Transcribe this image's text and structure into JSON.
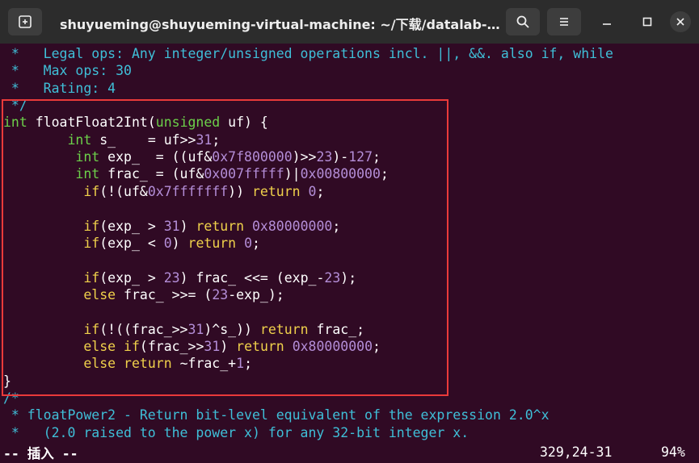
{
  "window": {
    "title": "shuyueming@shuyueming-virtual-machine: ~/下载/datalab-h..."
  },
  "lines": [
    {
      "segments": [
        {
          "c": "c",
          "t": " *   Legal ops: Any integer/unsigned operations incl. ||, &&. also if, while"
        }
      ]
    },
    {
      "segments": [
        {
          "c": "c",
          "t": " *   Max ops: 30"
        }
      ]
    },
    {
      "segments": [
        {
          "c": "c",
          "t": " *   Rating: 4"
        }
      ]
    },
    {
      "segments": [
        {
          "c": "c",
          "t": " */"
        }
      ]
    },
    {
      "segments": [
        {
          "c": "t",
          "t": "int"
        },
        {
          "c": "w",
          "t": " floatFloat2Int("
        },
        {
          "c": "t",
          "t": "unsigned"
        },
        {
          "c": "w",
          "t": " uf) {"
        }
      ]
    },
    {
      "segments": [
        {
          "c": "w",
          "t": "        "
        },
        {
          "c": "t",
          "t": "int"
        },
        {
          "c": "w",
          "t": " s_    = uf>>"
        },
        {
          "c": "n",
          "t": "31"
        },
        {
          "c": "w",
          "t": ";"
        }
      ]
    },
    {
      "segments": [
        {
          "c": "w",
          "t": "         "
        },
        {
          "c": "t",
          "t": "int"
        },
        {
          "c": "w",
          "t": " exp_  = ((uf&"
        },
        {
          "c": "n",
          "t": "0x7f800000"
        },
        {
          "c": "w",
          "t": ")>>"
        },
        {
          "c": "n",
          "t": "23"
        },
        {
          "c": "w",
          "t": ")-"
        },
        {
          "c": "n",
          "t": "127"
        },
        {
          "c": "w",
          "t": ";"
        }
      ]
    },
    {
      "segments": [
        {
          "c": "w",
          "t": "         "
        },
        {
          "c": "t",
          "t": "int"
        },
        {
          "c": "w",
          "t": " frac_ = (uf&"
        },
        {
          "c": "n",
          "t": "0x007fffff"
        },
        {
          "c": "w",
          "t": ")|"
        },
        {
          "c": "n",
          "t": "0x00800000"
        },
        {
          "c": "w",
          "t": ";"
        }
      ]
    },
    {
      "segments": [
        {
          "c": "w",
          "t": "          "
        },
        {
          "c": "k",
          "t": "if"
        },
        {
          "c": "w",
          "t": "(!(uf&"
        },
        {
          "c": "n",
          "t": "0x7fffffff"
        },
        {
          "c": "w",
          "t": ")) "
        },
        {
          "c": "k",
          "t": "return"
        },
        {
          "c": "w",
          "t": " "
        },
        {
          "c": "n",
          "t": "0"
        },
        {
          "c": "w",
          "t": ";"
        }
      ]
    },
    {
      "segments": [
        {
          "c": "w",
          "t": ""
        }
      ]
    },
    {
      "segments": [
        {
          "c": "w",
          "t": "          "
        },
        {
          "c": "k",
          "t": "if"
        },
        {
          "c": "w",
          "t": "(exp_ > "
        },
        {
          "c": "n",
          "t": "31"
        },
        {
          "c": "w",
          "t": ") "
        },
        {
          "c": "k",
          "t": "return"
        },
        {
          "c": "w",
          "t": " "
        },
        {
          "c": "n",
          "t": "0x80000000"
        },
        {
          "c": "w",
          "t": ";"
        }
      ]
    },
    {
      "segments": [
        {
          "c": "w",
          "t": "          "
        },
        {
          "c": "k",
          "t": "if"
        },
        {
          "c": "w",
          "t": "(exp_ < "
        },
        {
          "c": "n",
          "t": "0"
        },
        {
          "c": "w",
          "t": ") "
        },
        {
          "c": "k",
          "t": "return"
        },
        {
          "c": "w",
          "t": " "
        },
        {
          "c": "n",
          "t": "0"
        },
        {
          "c": "w",
          "t": ";"
        }
      ]
    },
    {
      "segments": [
        {
          "c": "w",
          "t": ""
        }
      ]
    },
    {
      "segments": [
        {
          "c": "w",
          "t": "          "
        },
        {
          "c": "k",
          "t": "if"
        },
        {
          "c": "w",
          "t": "(exp_ > "
        },
        {
          "c": "n",
          "t": "23"
        },
        {
          "c": "w",
          "t": ") frac_ <<= (exp_-"
        },
        {
          "c": "n",
          "t": "23"
        },
        {
          "c": "w",
          "t": ");"
        }
      ]
    },
    {
      "segments": [
        {
          "c": "w",
          "t": "          "
        },
        {
          "c": "k",
          "t": "else"
        },
        {
          "c": "w",
          "t": " frac_ >>= ("
        },
        {
          "c": "n",
          "t": "23"
        },
        {
          "c": "w",
          "t": "-exp_);"
        }
      ]
    },
    {
      "segments": [
        {
          "c": "w",
          "t": ""
        }
      ]
    },
    {
      "segments": [
        {
          "c": "w",
          "t": "          "
        },
        {
          "c": "k",
          "t": "if"
        },
        {
          "c": "w",
          "t": "(!((frac_>>"
        },
        {
          "c": "n",
          "t": "31"
        },
        {
          "c": "w",
          "t": ")^s_)) "
        },
        {
          "c": "k",
          "t": "return"
        },
        {
          "c": "w",
          "t": " frac_;"
        }
      ]
    },
    {
      "segments": [
        {
          "c": "w",
          "t": "          "
        },
        {
          "c": "k",
          "t": "else"
        },
        {
          "c": "w",
          "t": " "
        },
        {
          "c": "k",
          "t": "if"
        },
        {
          "c": "w",
          "t": "(frac_>>"
        },
        {
          "c": "n",
          "t": "31"
        },
        {
          "c": "w",
          "t": ") "
        },
        {
          "c": "k",
          "t": "return"
        },
        {
          "c": "w",
          "t": " "
        },
        {
          "c": "n",
          "t": "0x80000000"
        },
        {
          "c": "w",
          "t": ";"
        }
      ]
    },
    {
      "segments": [
        {
          "c": "w",
          "t": "          "
        },
        {
          "c": "k",
          "t": "else"
        },
        {
          "c": "w",
          "t": " "
        },
        {
          "c": "k",
          "t": "return"
        },
        {
          "c": "w",
          "t": " ~frac_+"
        },
        {
          "c": "n",
          "t": "1"
        },
        {
          "c": "w",
          "t": ";"
        }
      ]
    },
    {
      "segments": [
        {
          "c": "w",
          "t": "}"
        }
      ]
    },
    {
      "segments": [
        {
          "c": "c",
          "t": "/*"
        }
      ]
    },
    {
      "segments": [
        {
          "c": "c",
          "t": " * floatPower2 - Return bit-level equivalent of the expression 2.0^x"
        }
      ]
    },
    {
      "segments": [
        {
          "c": "c",
          "t": " *   (2.0 raised to the power x) for any 32-bit integer x."
        }
      ]
    }
  ],
  "status": {
    "mode": "-- 插入 --",
    "position": "329,24-31",
    "percent": "94%"
  },
  "colors": {
    "background": "#300a24",
    "comment": "#3fbfd8",
    "type": "#6cd04a",
    "keyword": "#f0d14b",
    "number": "#b48ed8",
    "selection_border": "#ea3a3a"
  },
  "icons": {
    "new_tab": "new-tab-icon",
    "search": "search-icon",
    "menu": "hamburger-menu-icon",
    "minimize": "minimize-icon",
    "maximize": "maximize-icon",
    "close": "close-icon"
  }
}
